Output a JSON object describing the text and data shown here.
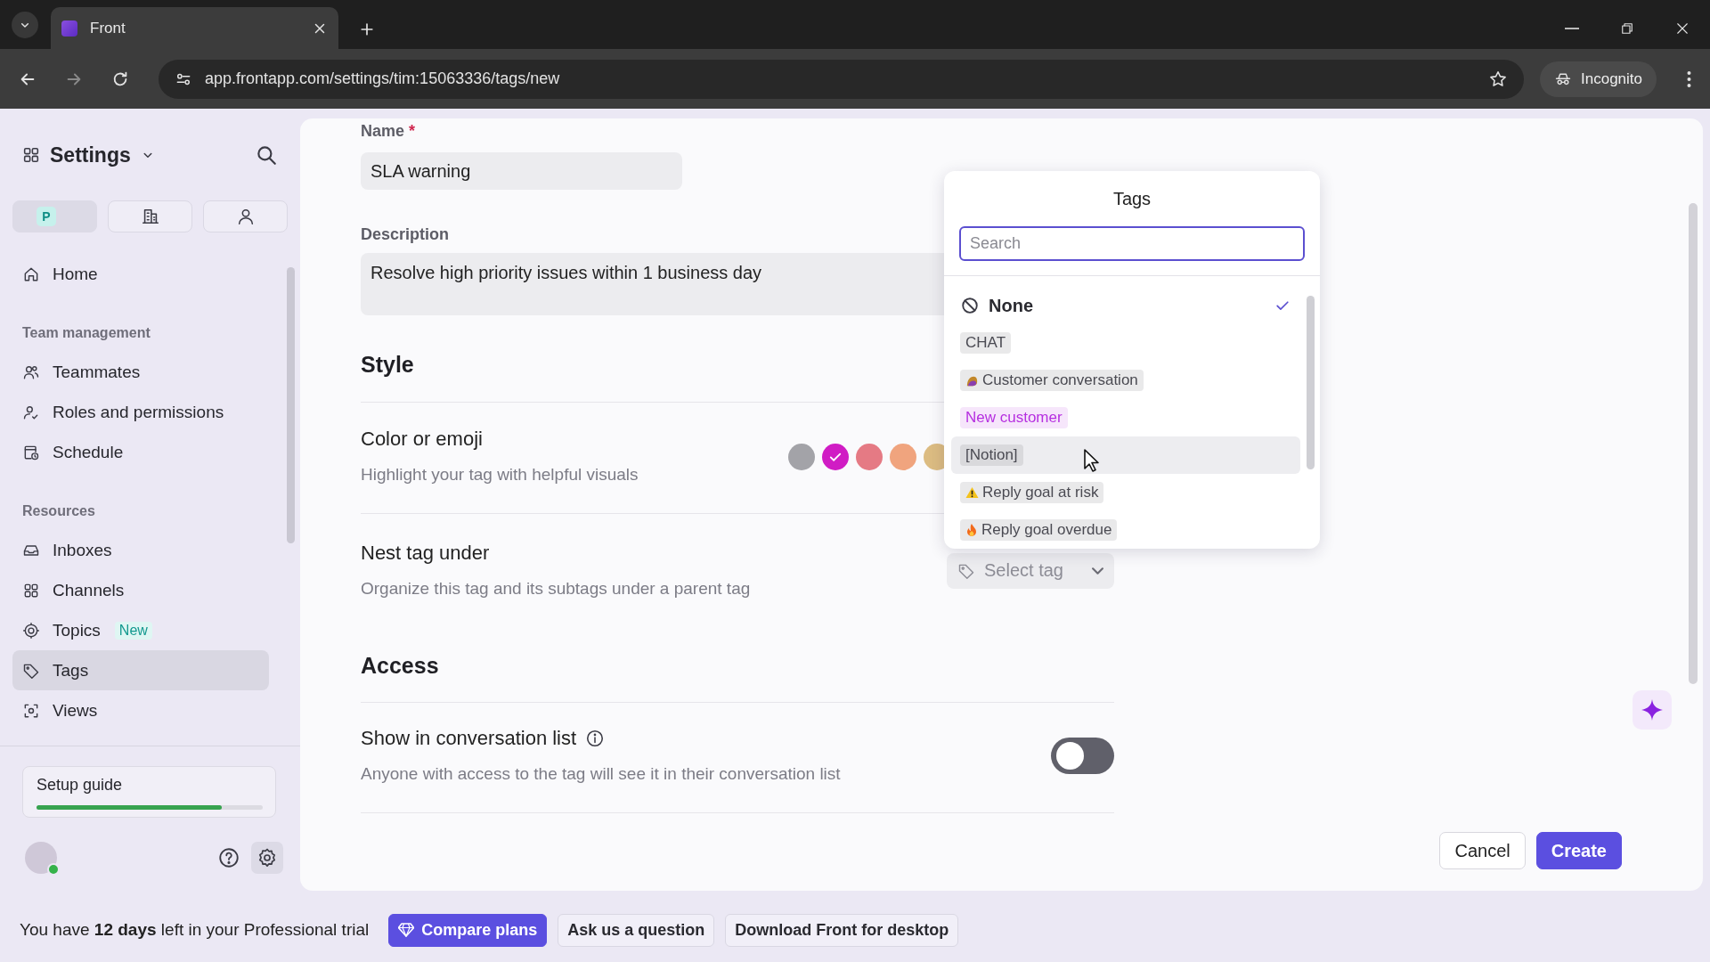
{
  "browser": {
    "tab_title": "Front",
    "url": "app.frontapp.com/settings/tim:15063336/tags/new",
    "profile": "Incognito"
  },
  "sidebar": {
    "title": "Settings",
    "switcher": [
      {
        "badge": "P",
        "selected": true
      },
      {
        "selected": false
      },
      {
        "selected": false
      }
    ],
    "groups": [
      {
        "items": [
          {
            "label": "Home",
            "selected": false
          }
        ]
      },
      {
        "heading": "Team management",
        "items": [
          {
            "label": "Teammates",
            "selected": false
          },
          {
            "label": "Roles and permissions",
            "selected": false
          },
          {
            "label": "Schedule",
            "selected": false
          }
        ]
      },
      {
        "heading": "Resources",
        "items": [
          {
            "label": "Inboxes",
            "selected": false
          },
          {
            "label": "Channels",
            "selected": false
          },
          {
            "label": "Topics",
            "badge": "New",
            "selected": false
          },
          {
            "label": "Tags",
            "selected": true
          },
          {
            "label": "Views",
            "selected": false
          }
        ]
      }
    ],
    "setup_guide": {
      "label": "Setup guide",
      "level": 0.82
    }
  },
  "form": {
    "name": {
      "label": "Name",
      "required_mark": "*",
      "value": "SLA warning"
    },
    "description": {
      "label": "Description",
      "value": "Resolve high priority issues within 1 business day"
    },
    "style": {
      "heading": "Style",
      "color_row": {
        "title": "Color or emoji",
        "subtitle": "Highlight your tag with helpful visuals",
        "colors": [
          {
            "color": "#a3a3a8",
            "selected": false
          },
          {
            "color": "#d01cc4",
            "selected": true
          },
          {
            "color": "#e57a84",
            "selected": false
          },
          {
            "color": "#f0a47e",
            "selected": false
          },
          {
            "color": "#dcbc82",
            "selected": false
          }
        ]
      },
      "nest_row": {
        "title": "Nest tag under",
        "subtitle": "Organize this tag and its subtags under a parent tag",
        "select": "Select tag"
      }
    },
    "access": {
      "heading": "Access",
      "rows": [
        {
          "title": "Show in conversation list",
          "subtitle": "Anyone with access to the tag will see it in their conversation list",
          "on": false
        }
      ]
    },
    "buttons": [
      {
        "label": "Cancel",
        "kind": "secondary"
      },
      {
        "label": "Create",
        "kind": "primary"
      }
    ]
  },
  "dropdown": {
    "title": "Tags",
    "search": {
      "placeholder": "Search"
    },
    "options": [
      {
        "label": "None",
        "kind": "none",
        "selected": true,
        "hovered": false
      },
      {
        "label": "CHAT",
        "kind": "plain",
        "color": "#4a4a52",
        "selected": false,
        "hovered": false
      },
      {
        "label": "Customer conversation",
        "kind": "mascot",
        "color": "#4a4a52",
        "selected": false,
        "hovered": false
      },
      {
        "label": "New customer",
        "kind": "plain",
        "color": "#b62fe0",
        "selected": false,
        "hovered": false
      },
      {
        "label": "[Notion]",
        "kind": "plain",
        "color": "#4a4a52",
        "selected": false,
        "hovered": true
      },
      {
        "label": "Reply goal at risk",
        "kind": "warning",
        "color": "#4a4a52",
        "selected": false,
        "hovered": false
      },
      {
        "label": "Reply goal overdue",
        "kind": "fire",
        "color": "#4a4a52",
        "selected": false,
        "hovered": false
      }
    ]
  },
  "trial": {
    "message": "You have **12 days** left in your Professional trial",
    "buttons": [
      {
        "label": "Compare plans",
        "kind": "primary"
      },
      {
        "label": "Ask us a question",
        "kind": "plain"
      },
      {
        "label": "Download Front for desktop",
        "kind": "plain"
      }
    ]
  }
}
